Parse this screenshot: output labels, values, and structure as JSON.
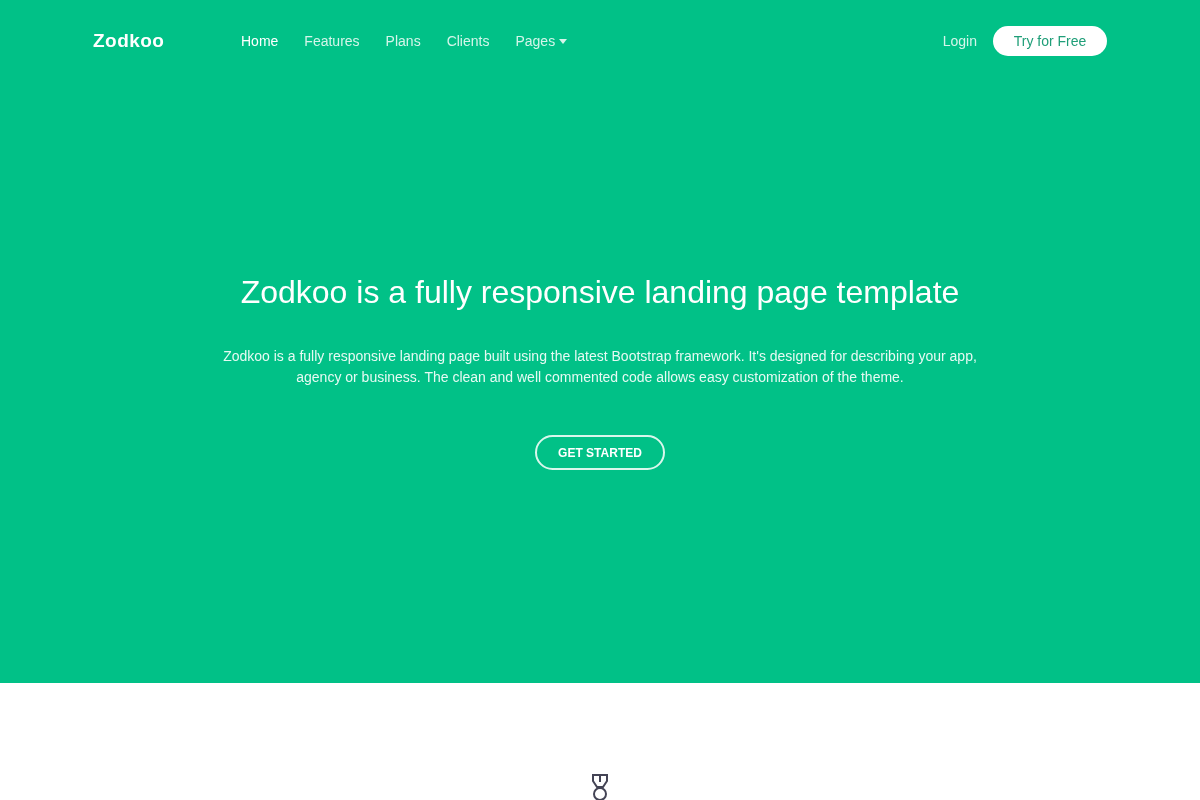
{
  "brand": "Zodkoo",
  "nav": [
    {
      "label": "Home",
      "selected": true,
      "dropdown": false
    },
    {
      "label": "Features",
      "selected": false,
      "dropdown": false
    },
    {
      "label": "Plans",
      "selected": false,
      "dropdown": false
    },
    {
      "label": "Clients",
      "selected": false,
      "dropdown": false
    },
    {
      "label": "Pages",
      "selected": false,
      "dropdown": true
    }
  ],
  "login": "Login",
  "cta": "Try for Free",
  "hero": {
    "title": "Zodkoo is a fully responsive landing page template",
    "text": "Zodkoo is a fully responsive landing page built using the latest Bootstrap framework. It's designed for describing your app, agency or business. The clean and well commented code allows easy customization of the theme.",
    "button": "GET STARTED"
  }
}
